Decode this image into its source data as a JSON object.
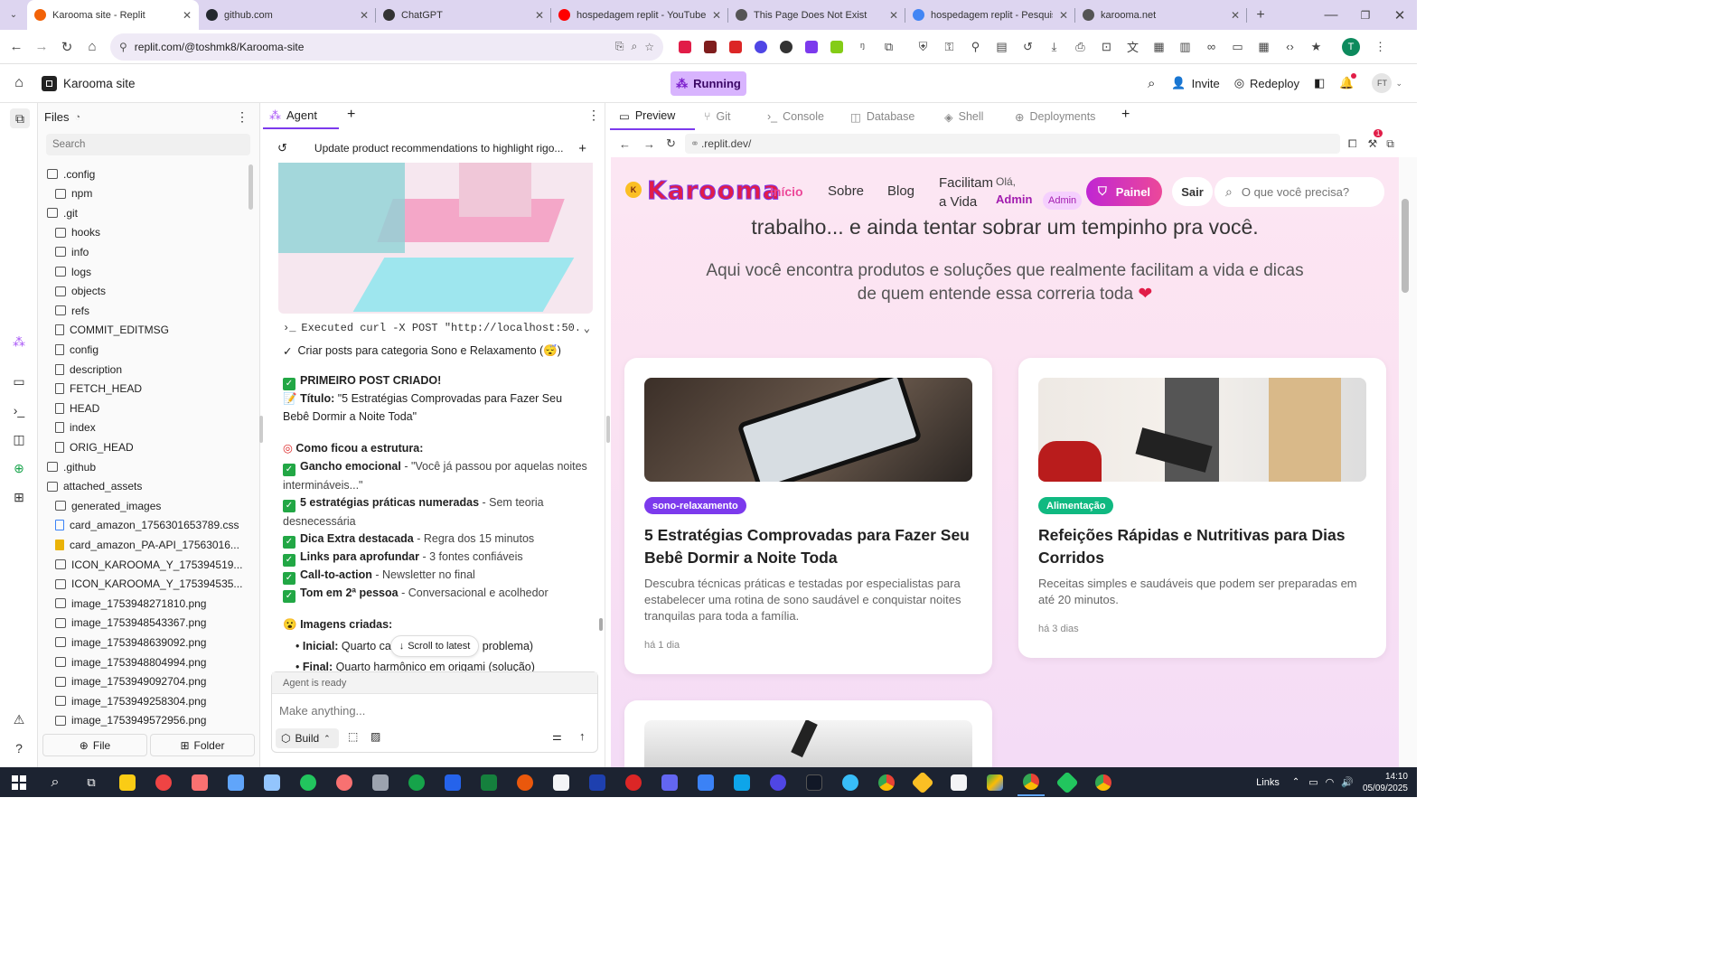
{
  "browser": {
    "tabs": [
      {
        "title": "Karooma site - Replit",
        "active": true,
        "icon": "replit-icon",
        "color": "#f26207"
      },
      {
        "title": "github.com",
        "icon": "github-icon",
        "color": "#24292f"
      },
      {
        "title": "ChatGPT",
        "icon": "chatgpt-icon",
        "color": "#333333"
      },
      {
        "title": "hospedagem replit - YouTube",
        "icon": "youtube-icon",
        "color": "#ff0000"
      },
      {
        "title": "This Page Does Not Exist",
        "icon": "globe-icon",
        "color": "#555555"
      },
      {
        "title": "hospedagem replit - Pesquisa G",
        "icon": "google-icon",
        "color": "#4285f4"
      },
      {
        "title": "karooma.net",
        "icon": "globe-icon",
        "color": "#555555"
      }
    ],
    "url": "replit.com/@toshmk8/Karooma-site",
    "profile_initial": "T"
  },
  "replit": {
    "project_name": "Karooma site",
    "run_status": "Running",
    "invite_label": "Invite",
    "redeploy_label": "Redeploy",
    "avatar_initials": "FT"
  },
  "files_panel": {
    "title": "Files",
    "search_placeholder": "Search",
    "items": [
      {
        "name": ".config",
        "type": "folder",
        "depth": 0
      },
      {
        "name": "npm",
        "type": "folder",
        "depth": 1
      },
      {
        "name": ".git",
        "type": "folder",
        "depth": 0
      },
      {
        "name": "hooks",
        "type": "folder",
        "depth": 1
      },
      {
        "name": "info",
        "type": "folder",
        "depth": 1
      },
      {
        "name": "logs",
        "type": "folder",
        "depth": 1
      },
      {
        "name": "objects",
        "type": "folder",
        "depth": 1
      },
      {
        "name": "refs",
        "type": "folder",
        "depth": 1
      },
      {
        "name": "COMMIT_EDITMSG",
        "type": "file",
        "depth": 1
      },
      {
        "name": "config",
        "type": "file",
        "depth": 1
      },
      {
        "name": "description",
        "type": "file",
        "depth": 1
      },
      {
        "name": "FETCH_HEAD",
        "type": "file",
        "depth": 1
      },
      {
        "name": "HEAD",
        "type": "file",
        "depth": 1
      },
      {
        "name": "index",
        "type": "file",
        "depth": 1
      },
      {
        "name": "ORIG_HEAD",
        "type": "file",
        "depth": 1
      },
      {
        "name": ".github",
        "type": "folder",
        "depth": 0
      },
      {
        "name": "attached_assets",
        "type": "folder",
        "depth": 0
      },
      {
        "name": "generated_images",
        "type": "folder",
        "depth": 1
      },
      {
        "name": "card_amazon_1756301653789.css",
        "type": "css",
        "depth": 1
      },
      {
        "name": "card_amazon_PA-API_17563016...",
        "type": "js",
        "depth": 1
      },
      {
        "name": "ICON_KAROOMA_Y_175394519...",
        "type": "image",
        "depth": 1
      },
      {
        "name": "ICON_KAROOMA_Y_175394535...",
        "type": "image",
        "depth": 1
      },
      {
        "name": "image_1753948271810.png",
        "type": "image",
        "depth": 1
      },
      {
        "name": "image_1753948543367.png",
        "type": "image",
        "depth": 1
      },
      {
        "name": "image_1753948639092.png",
        "type": "image",
        "depth": 1
      },
      {
        "name": "image_1753948804994.png",
        "type": "image",
        "depth": 1
      },
      {
        "name": "image_1753949092704.png",
        "type": "image",
        "depth": 1
      },
      {
        "name": "image_1753949258304.png",
        "type": "image",
        "depth": 1
      },
      {
        "name": "image_1753949572956.png",
        "type": "image",
        "depth": 1
      }
    ],
    "new_file_label": "File",
    "new_folder_label": "Folder"
  },
  "agent_panel": {
    "tab_label": "Agent",
    "history_title": "Update product recommendations to highlight rigo...",
    "executed": "Executed curl -X POST \"http://localhost:50...",
    "task_done": "Criar posts para categoria Sono e Relaxamento (😴)",
    "post_created": "PRIMEIRO POST CRIADO!",
    "title_label": "Título:",
    "title_value": "\"5 Estratégias Comprovadas para Fazer Seu Bebê Dormir a Noite Toda\"",
    "structure_heading": "Como ficou a estrutura:",
    "structure": [
      {
        "bold": "Gancho emocional",
        "rest": " - \"Você já passou por aquelas noites intermináveis...\""
      },
      {
        "bold": "5 estratégias práticas numeradas",
        "rest": " - Sem teoria desnecessária"
      },
      {
        "bold": "Dica Extra destacada",
        "rest": " - Regra dos 15 minutos"
      },
      {
        "bold": "Links para aprofundar",
        "rest": " - 3 fontes confiáveis"
      },
      {
        "bold": "Call-to-action",
        "rest": " - Newsletter no final"
      },
      {
        "bold": "Tom em 2ª pessoa",
        "rest": " - Conversacional e acolhedor"
      }
    ],
    "images_heading": "Imagens criadas:",
    "image_items": [
      {
        "bold": "Inicial:",
        "rest": " Quarto caó",
        "rest2": "problema)"
      },
      {
        "bold": "Final:",
        "rest": " Quarto harmônico em origami (solução)"
      }
    ],
    "scroll_latest": "Scroll to latest",
    "status": "Agent is ready",
    "input_placeholder": "Make anything...",
    "mode_label": "Build"
  },
  "preview_panel": {
    "tabs": [
      "Preview",
      "Git",
      "Console",
      "Database",
      "Shell",
      "Deployments"
    ],
    "url": ".replit.dev/",
    "notification_count": "1"
  },
  "site": {
    "logo": "Karooma",
    "nav": [
      "Início",
      "Sobre",
      "Blog"
    ],
    "nav_facilitam": "Facilitam a Vida",
    "greeting": "Olá,",
    "greeting_name": "Admin",
    "role_badge": "Admin",
    "painel_label": "Painel",
    "sair_label": "Sair",
    "search_placeholder": "O que você precisa?",
    "hero_line_cut": "trabalho... e ainda tentar sobrar um tempinho pra você.",
    "hero_sub": "Aqui você encontra produtos e soluções que realmente facilitam a vida e dicas de quem entende essa correria toda",
    "posts": [
      {
        "category": "sono-relaxamento",
        "category_color": "#7c3aed",
        "title": "5 Estratégias Comprovadas para Fazer Seu Bebê Dormir a Noite Toda",
        "description": "Descubra técnicas práticas e testadas por especialistas para estabelecer uma rotina de sono saudável e conquistar noites tranquilas para toda a família.",
        "date": "há 1 dia"
      },
      {
        "category": "Alimentação",
        "category_color": "#10b981",
        "title": "Refeições Rápidas e Nutritivas para Dias Corridos",
        "description": "Receitas simples e saudáveis que podem ser preparadas em até 20 minutos.",
        "date": "há 3 dias"
      }
    ]
  },
  "taskbar": {
    "links_label": "Links",
    "time": "14:10",
    "date": "05/09/2025"
  },
  "colors": {
    "accent_purple": "#a855f7",
    "painel_gradient_start": "#c026d3",
    "running_bg": "#d8b4fe"
  }
}
